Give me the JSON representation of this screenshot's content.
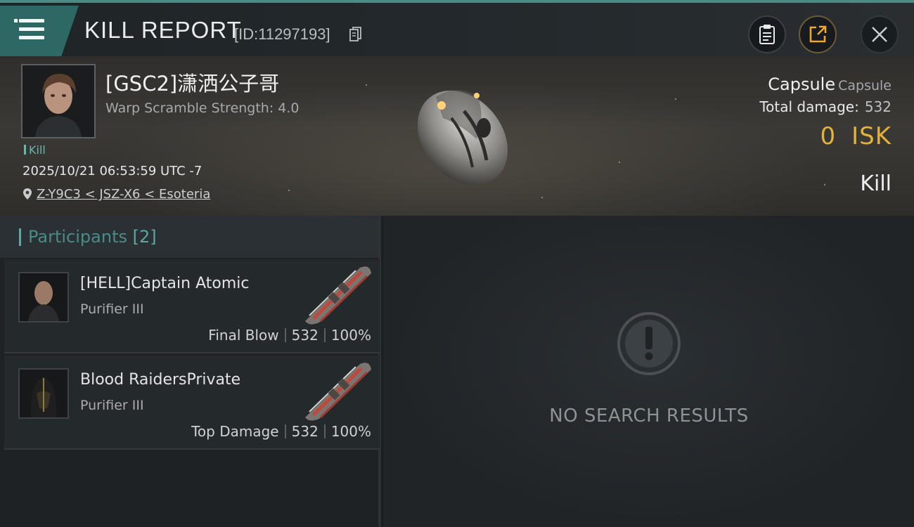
{
  "header": {
    "title": "KILL REPORT",
    "report_id": "[ID:11297193]",
    "icons": {
      "menu": "menu-icon",
      "copy": "copy-icon",
      "clipboard": "clipboard-icon",
      "share": "share-icon",
      "close": "close-icon"
    }
  },
  "victim": {
    "name": "[GSC2]潇洒公子哥",
    "subtitle": "Warp Scramble Strength: 4.0",
    "tag": "Kill",
    "datetime": "2025/10/21 06:53:59 UTC -7",
    "location": "Z-Y9C3 < JSZ-X6 < Esoteria",
    "ship_name": "Capsule",
    "ship_class": "Capsule",
    "total_damage_label": "Total damage:",
    "total_damage_value": "532",
    "isk_value": "0",
    "isk_unit": "ISK",
    "result": "Kill"
  },
  "participants": {
    "title": "Participants",
    "count": "[2]",
    "rows": [
      {
        "name": "[HELL]Captain Atomic",
        "ship": "Purifier III",
        "role": "Final Blow",
        "damage": "532",
        "percent": "100%"
      },
      {
        "name": "Blood RaidersPrivate",
        "ship": "Purifier III",
        "role": "Top Damage",
        "damage": "532",
        "percent": "100%"
      }
    ]
  },
  "results_panel": {
    "empty_text": "NO SEARCH RESULTS",
    "icon": "alert-icon"
  },
  "colors": {
    "accent_teal": "#2e6864",
    "isk_gold": "#e3b23c",
    "tag_teal": "#68b7b1"
  }
}
